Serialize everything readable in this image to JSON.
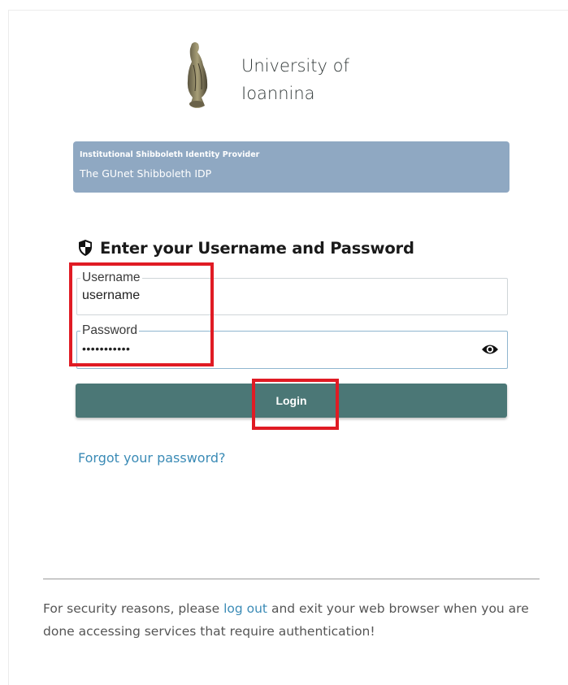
{
  "branding": {
    "university_line1": "University of",
    "university_line2": "Ioannina",
    "logo_icon": "owl-statue-icon"
  },
  "banner": {
    "title": "Institutional Shibboleth Identity Provider",
    "subtitle": "The GUnet Shibboleth IDP",
    "color": "#8fa8c2"
  },
  "form": {
    "heading": "Enter your Username and Password",
    "heading_icon": "shield-icon",
    "username_label": "Username",
    "username_value": "username",
    "password_label": "Password",
    "password_value": "•••••••••••",
    "show_password_icon": "eye-icon",
    "login_label": "Login",
    "login_color": "#4b7776",
    "forgot_link": "Forgot your password?"
  },
  "footer": {
    "text_before": "For security reasons, please ",
    "logout_link": "log out",
    "text_after": " and exit your web browser when you are done accessing services that require authentication!"
  },
  "annotations": {
    "highlight_color": "#e01b24"
  }
}
